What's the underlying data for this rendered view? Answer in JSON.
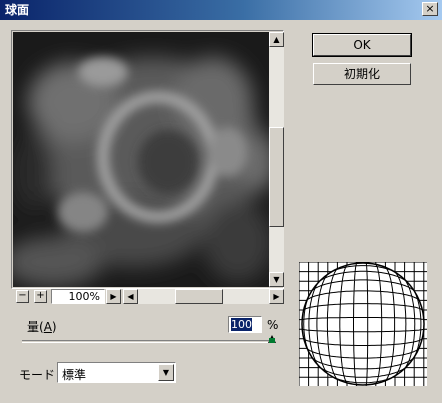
{
  "window": {
    "title": "球面",
    "close_glyph": "×"
  },
  "preview": {
    "zoom": "100%",
    "zoom_out": "−",
    "zoom_in": "+"
  },
  "buttons": {
    "ok": "OK",
    "reset": "初期化"
  },
  "amount": {
    "label": "量(",
    "mnemonic": "A",
    "label_end": ")",
    "value": "100",
    "unit": "%",
    "slider_fraction": 1.0
  },
  "mode": {
    "label": "モード",
    "selected": "標準"
  },
  "scroll_glyphs": {
    "up": "▲",
    "down": "▼",
    "left": "◀",
    "right": "▶"
  }
}
